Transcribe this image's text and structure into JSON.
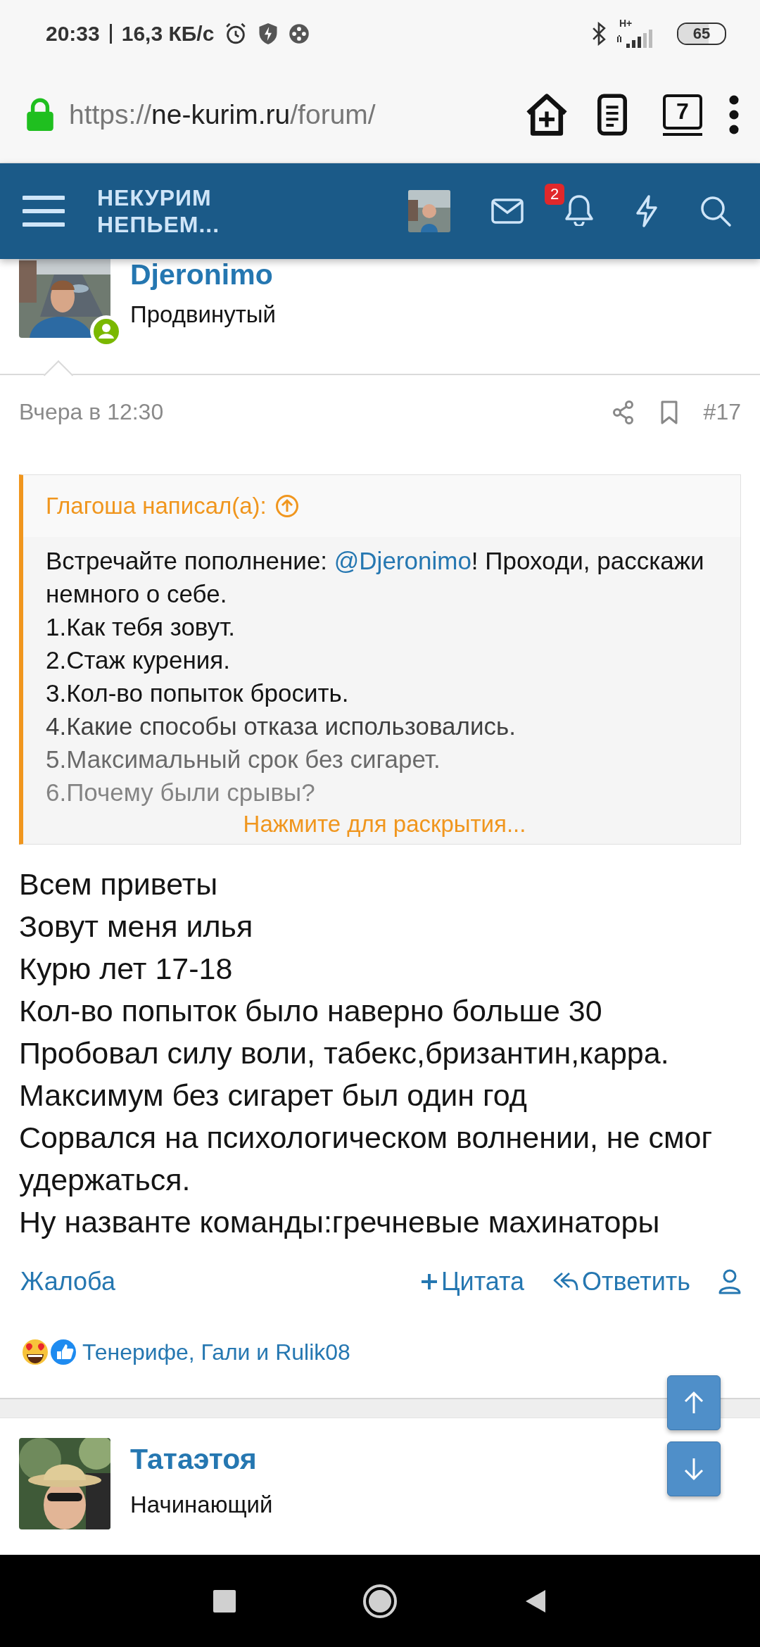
{
  "status_bar": {
    "time": "20:33",
    "speed": "16,3 КБ/с",
    "network": "H+",
    "battery": "65"
  },
  "browser": {
    "url_scheme": "https://",
    "url_host": "ne-kurim.ru",
    "url_path": "/forum/",
    "tabs_count": "7"
  },
  "header": {
    "logo": [
      "НЕКУРИМ",
      "НЕПЬЕМ..."
    ],
    "notifications": "2"
  },
  "post": {
    "author": "Djeronimo",
    "rank": "Продвинутый",
    "online": true,
    "date": "Вчера в 12:30",
    "number": "#17",
    "quote": {
      "author": "Глагоша написал(а):",
      "intro": {
        "before": "Встречайте пополнение: ",
        "mention": "@Djeronimo",
        "after": "! Проходи, расскажи немного о себе."
      },
      "lines": [
        "1.Как тебя зовут.",
        "2.Стаж курения.",
        "3.Кол-во попыток бросить.",
        "4.Какие способы отказа использовались.",
        "5.Максимальный срок без сигарет.",
        "6.Почему были срывы?"
      ],
      "expand": "Нажмите для раскрытия..."
    },
    "body": [
      "Всем приветы",
      "Зовут меня илья",
      "Курю лет 17-18",
      "Кол-во попыток было наверно больше 30",
      "Пробовал силу воли, табекс,бризантин,карра.",
      "Максимум без сигарет был один год",
      "Сорвался на психологическом волнении, не смог удержаться.",
      "Ну названте команды:гречневые махинаторы"
    ],
    "actions": {
      "report": "Жалоба",
      "quote": "Цитата",
      "reply": "Ответить"
    },
    "reactions": "Тенерифе, Гали и Rulik08"
  },
  "next_post": {
    "author": "Татаэтоя",
    "rank": "Начинающий"
  }
}
